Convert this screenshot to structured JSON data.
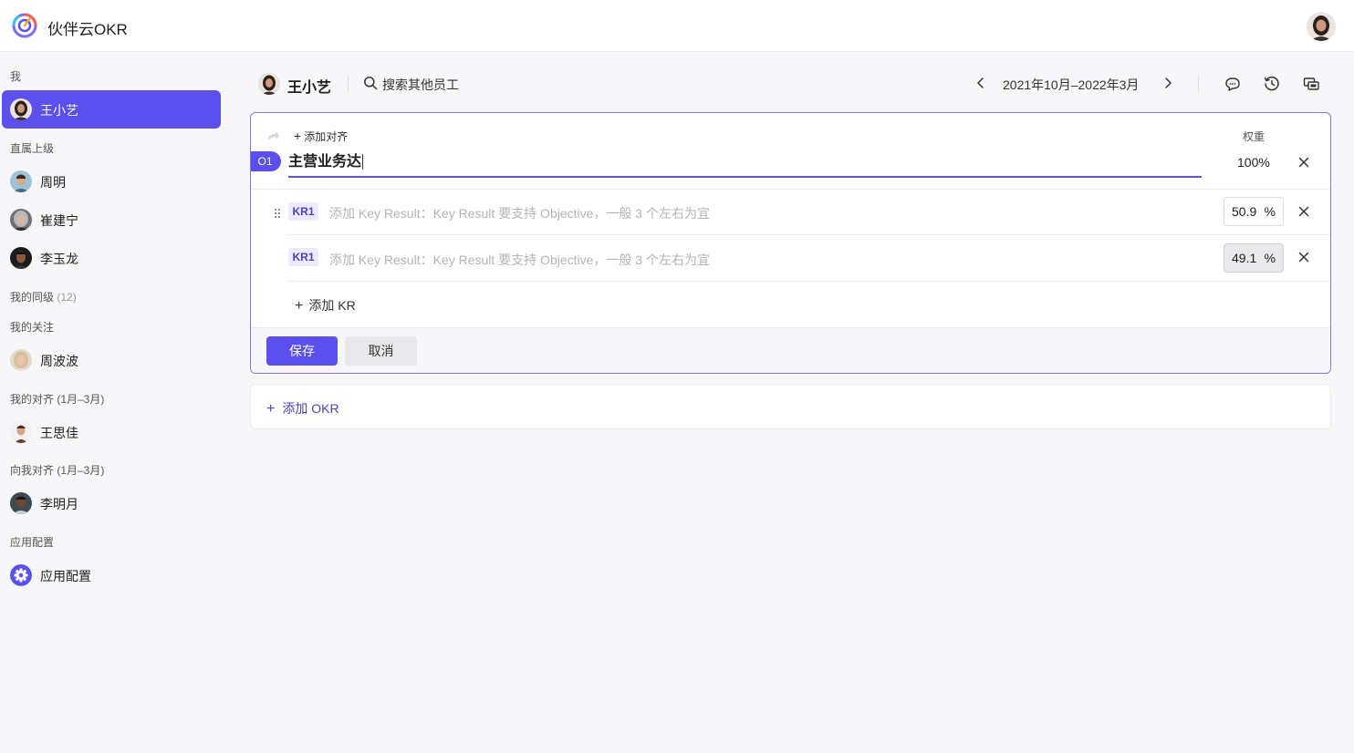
{
  "app": {
    "name": "伙伴云OKR",
    "logo_icon": "okr-logo-icon",
    "accent_color": "#5b50ee"
  },
  "topbar": {
    "user_avatar_icon": "user-avatar-icon"
  },
  "sidebar": {
    "section_me": "我",
    "me": {
      "name": "王小艺"
    },
    "section_superior": "直属上级",
    "superiors": [
      {
        "name": "周明"
      },
      {
        "name": "崔建宁"
      },
      {
        "name": "李玉龙"
      }
    ],
    "section_peers": "我的同级",
    "peers_count": "(12)",
    "section_following": "我的关注",
    "following": [
      {
        "name": "周波波"
      }
    ],
    "section_my_alignment": "我的对齐 (1月–3月)",
    "my_alignment": [
      {
        "name": "王思佳"
      }
    ],
    "section_aligned_to_me": "向我对齐 (1月–3月)",
    "aligned_to_me": [
      {
        "name": "李明月"
      }
    ],
    "section_app_config": "应用配置",
    "app_config": {
      "label": "应用配置",
      "icon": "gear-icon"
    }
  },
  "header": {
    "user_name": "王小艺",
    "search_label": "搜索其他员工",
    "period": "2021年10月–2022年3月",
    "tools": [
      "comment-icon",
      "history-icon",
      "switch-view-icon"
    ]
  },
  "okr_editor": {
    "add_alignment": "添加对齐",
    "weight_header": "权重",
    "objective": {
      "badge": "O1",
      "text": "主营业务达",
      "weight": "100%"
    },
    "key_results": [
      {
        "badge": "KR1",
        "placeholder": "添加 Key Result：Key Result 要支持 Objective，一般 3 个左右为宜",
        "weight": "50.9",
        "unit": "%"
      },
      {
        "badge": "KR1",
        "placeholder": "添加 Key Result：Key Result 要支持 Objective，一般 3 个左右为宜",
        "weight": "49.1",
        "unit": "%"
      }
    ],
    "add_kr": "添加 KR",
    "save": "保存",
    "cancel": "取消"
  },
  "add_okr": "添加 OKR"
}
